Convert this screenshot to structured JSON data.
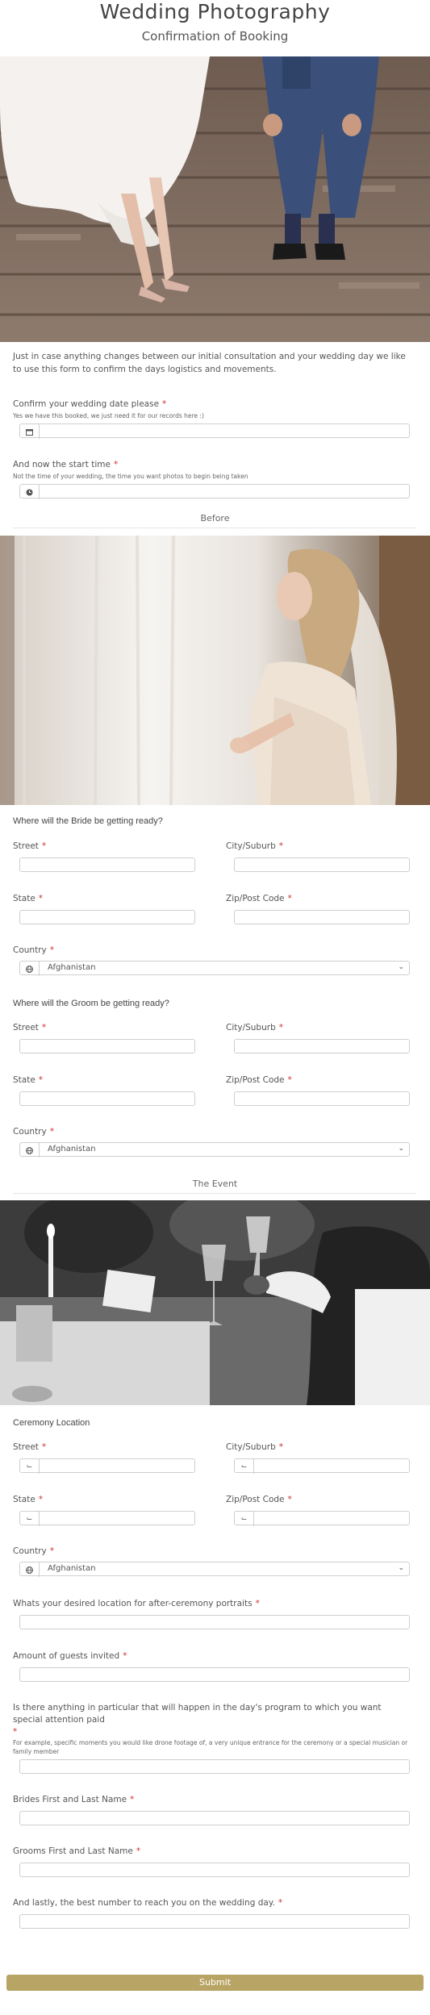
{
  "header": {
    "title": "Wedding Photography",
    "subtitle": "Confirmation of Booking"
  },
  "intro": "Just in case anything changes between our initial consultation and your wedding day we like to use this form to confirm the days logistics and movements.",
  "date_field": {
    "label": "Confirm your wedding date please",
    "required": "*",
    "sublabel": "Yes we have this booked, we just need it for our records here :)",
    "icon": "calendar-icon"
  },
  "time_field": {
    "label": "And now the start time",
    "required": "*",
    "sublabel": "Not the time of your wedding, the time you want photos to begin being taken",
    "icon": "clock-icon"
  },
  "section_before": "Before",
  "bride": {
    "heading": "Where will the Bride be getting ready?",
    "street": "Street",
    "city": "City/Suburb",
    "state": "State",
    "zip": "Zip/Post Code",
    "country": "Country",
    "country_value": "Afghanistan",
    "req": "*"
  },
  "groom": {
    "heading": "Where will the Groom be getting ready?",
    "street": "Street",
    "city": "City/Suburb",
    "state": "State",
    "zip": "Zip/Post Code",
    "country": "Country",
    "country_value": "Afghanistan",
    "req": "*"
  },
  "section_event": "The Event",
  "ceremony": {
    "heading": "Ceremony Location",
    "street": "Street",
    "city": "City/Suburb",
    "state": "State",
    "zip": "Zip/Post Code",
    "country": "Country",
    "country_value": "Afghanistan",
    "req": "*"
  },
  "questions": {
    "portraits": "Whats your desired location for after-ceremony portraits",
    "guests": "Amount of guests invited",
    "program": "Is there anything in particular that will happen in the day's program to which you want special attention paid",
    "program_sub": "For example, specific moments you would like drone footage of, a very unique entrance for the ceremony or a special musician or family member",
    "bride_name": "Brides First and Last Name",
    "groom_name": "Grooms First and Last Name",
    "phone": "And lastly, the best number to reach you on the wedding day.",
    "req": "*"
  },
  "submit_label": "Submit",
  "colors": {
    "submit_bg": "#b8a565",
    "required": "#cc3333"
  }
}
